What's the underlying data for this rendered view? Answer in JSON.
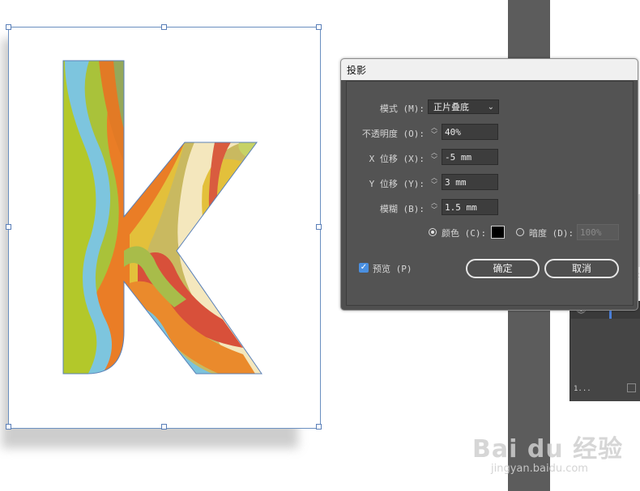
{
  "dialog": {
    "title": "投影",
    "mode_label": "模式 (M):",
    "mode_value": "正片叠底",
    "opacity_label": "不透明度 (O):",
    "opacity_value": "40%",
    "x_offset_label": "X 位移 (X):",
    "x_offset_value": "-5 mm",
    "y_offset_label": "Y 位移 (Y):",
    "y_offset_value": "3 mm",
    "blur_label": "模糊 (B):",
    "blur_value": "1.5 mm",
    "color_label": "颜色 (C):",
    "color_swatch": "#000000",
    "darkness_label": "暗度 (D):",
    "darkness_value": "100%",
    "preview_label": "预览 (P)",
    "preview_checked": true,
    "ok_label": "确定",
    "cancel_label": "取消"
  },
  "side_panel": {
    "text": "1..."
  },
  "watermark": {
    "main": "Bai du 经验",
    "sub": "jingyan.baidu.com"
  },
  "colors": {
    "accent": "#4a8fe0",
    "dialog_bg": "#535353",
    "artboard_border": "#6a8fc0"
  },
  "icons": [
    "chevron-down-icon",
    "spin-up-down-icon",
    "radio-icon",
    "checkbox-check-icon",
    "eye-icon",
    "expand-icon",
    "paw-icon"
  ]
}
